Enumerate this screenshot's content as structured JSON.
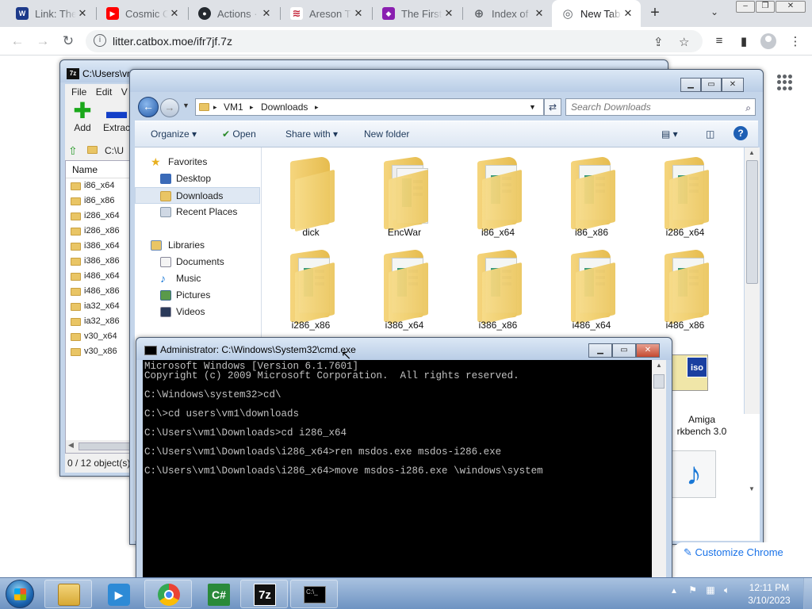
{
  "browser": {
    "tabs": [
      {
        "title": "Link: The",
        "icon": "link-favicon",
        "color": "#1d3a8a",
        "glyph": "W"
      },
      {
        "title": "Cosmic C",
        "icon": "youtube-favicon",
        "color": "#ff0000",
        "glyph": "▶"
      },
      {
        "title": "Actions ·",
        "icon": "github-favicon",
        "color": "#24292f",
        "glyph": "●"
      },
      {
        "title": "Areson T",
        "icon": "areson-favicon",
        "color": "#c4253a",
        "glyph": "≋"
      },
      {
        "title": "The First",
        "icon": "the-first-favicon",
        "color": "#8a1fb0",
        "glyph": "◆"
      },
      {
        "title": "Index of",
        "icon": "globe-favicon",
        "color": "#5f6368",
        "glyph": "⊕"
      },
      {
        "title": "New Tab",
        "icon": "chrome-favicon",
        "color": "#5f6368",
        "glyph": "◎"
      }
    ],
    "new_tab_glyph": "+",
    "url": "litter.catbox.moe/ifr7jf.7z",
    "customize_label": "Customize Chrome"
  },
  "sevenzip": {
    "title": "C:\\Users\\vm",
    "menu": [
      "File",
      "Edit",
      "V"
    ],
    "toolbar": [
      {
        "label": "Add",
        "icon": "add-plus-icon"
      },
      {
        "label": "Extract",
        "icon": "extract-minus-icon"
      }
    ],
    "address": "C:\\U",
    "column_name": "Name",
    "files": [
      "i86_x64",
      "i86_x86",
      "i286_x64",
      "i286_x86",
      "i386_x64",
      "i386_x86",
      "i486_x64",
      "i486_x86",
      "ia32_x64",
      "ia32_x86",
      "v30_x64",
      "v30_x86"
    ],
    "status": "0 / 12 object(s)"
  },
  "explorer": {
    "breadcrumb": [
      "VM1",
      "Downloads"
    ],
    "search_placeholder": "Search Downloads",
    "commands": {
      "organize": "Organize",
      "open": "Open",
      "share": "Share with",
      "new_folder": "New folder"
    },
    "nav": {
      "favorites": "Favorites",
      "desktop": "Desktop",
      "downloads": "Downloads",
      "recent": "Recent Places",
      "libraries": "Libraries",
      "documents": "Documents",
      "music": "Music",
      "pictures": "Pictures",
      "videos": "Videos"
    },
    "items": [
      {
        "label": "dick",
        "kind": "folder-empty"
      },
      {
        "label": "EncWar",
        "kind": "folder-docs"
      },
      {
        "label": "i86_x64",
        "kind": "folder-paper"
      },
      {
        "label": "i86_x86",
        "kind": "folder-paper"
      },
      {
        "label": "i286_x64",
        "kind": "folder-paper"
      },
      {
        "label": "i286_x86",
        "kind": "folder-paper"
      },
      {
        "label": "i386_x64",
        "kind": "folder-paper"
      },
      {
        "label": "i386_x86",
        "kind": "folder-paper"
      },
      {
        "label": "i486_x64",
        "kind": "folder-paper"
      },
      {
        "label": "i486_x86",
        "kind": "folder-paper"
      }
    ],
    "extra": {
      "amiga_line1": "Amiga",
      "amiga_line2": "rkbench 3.0",
      "iso_glyph": "iso"
    }
  },
  "cmd": {
    "title": "Administrator: C:\\Windows\\System32\\cmd.exe",
    "lines": [
      "Microsoft Windows [Version 6.1.7601]",
      "Copyright (c) 2009 Microsoft Corporation.  All rights reserved.",
      "",
      "C:\\Windows\\system32>cd\\",
      "",
      "C:\\>cd users\\vm1\\downloads",
      "",
      "C:\\Users\\vm1\\Downloads>cd i286_x64",
      "",
      "C:\\Users\\vm1\\Downloads\\i286_x64>ren msdos.exe msdos-i286.exe",
      "",
      "C:\\Users\\vm1\\Downloads\\i286_x64>move msdos-i286.exe \\windows\\system"
    ]
  },
  "taskbar": {
    "time": "12:11 PM",
    "date": "3/10/2023",
    "tray_arrow": "▲",
    "sevenzip_label": "7z",
    "cmd_label": "C:\\_"
  }
}
